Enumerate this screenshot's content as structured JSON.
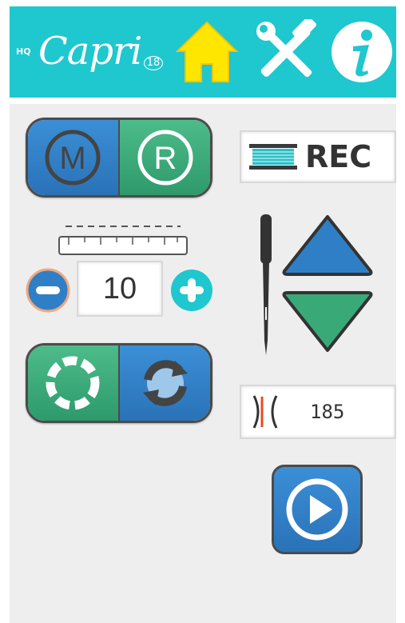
{
  "header": {
    "brand_prefix": "HQ",
    "brand_name": "Capri",
    "brand_number": "18",
    "icons": [
      "home-icon",
      "tools-icon",
      "info-icon"
    ]
  },
  "controls": {
    "mode_manual_label": "M",
    "mode_regulated_label": "R",
    "stitch_length_value": "10",
    "record_label": "REC",
    "stitch_count": "185"
  },
  "colors": {
    "header_bg": "#1fc7cf",
    "blue": "#2f7fc6",
    "green": "#3aa978",
    "home_yellow": "#ffe600",
    "panel_bg": "#eeeeee"
  }
}
